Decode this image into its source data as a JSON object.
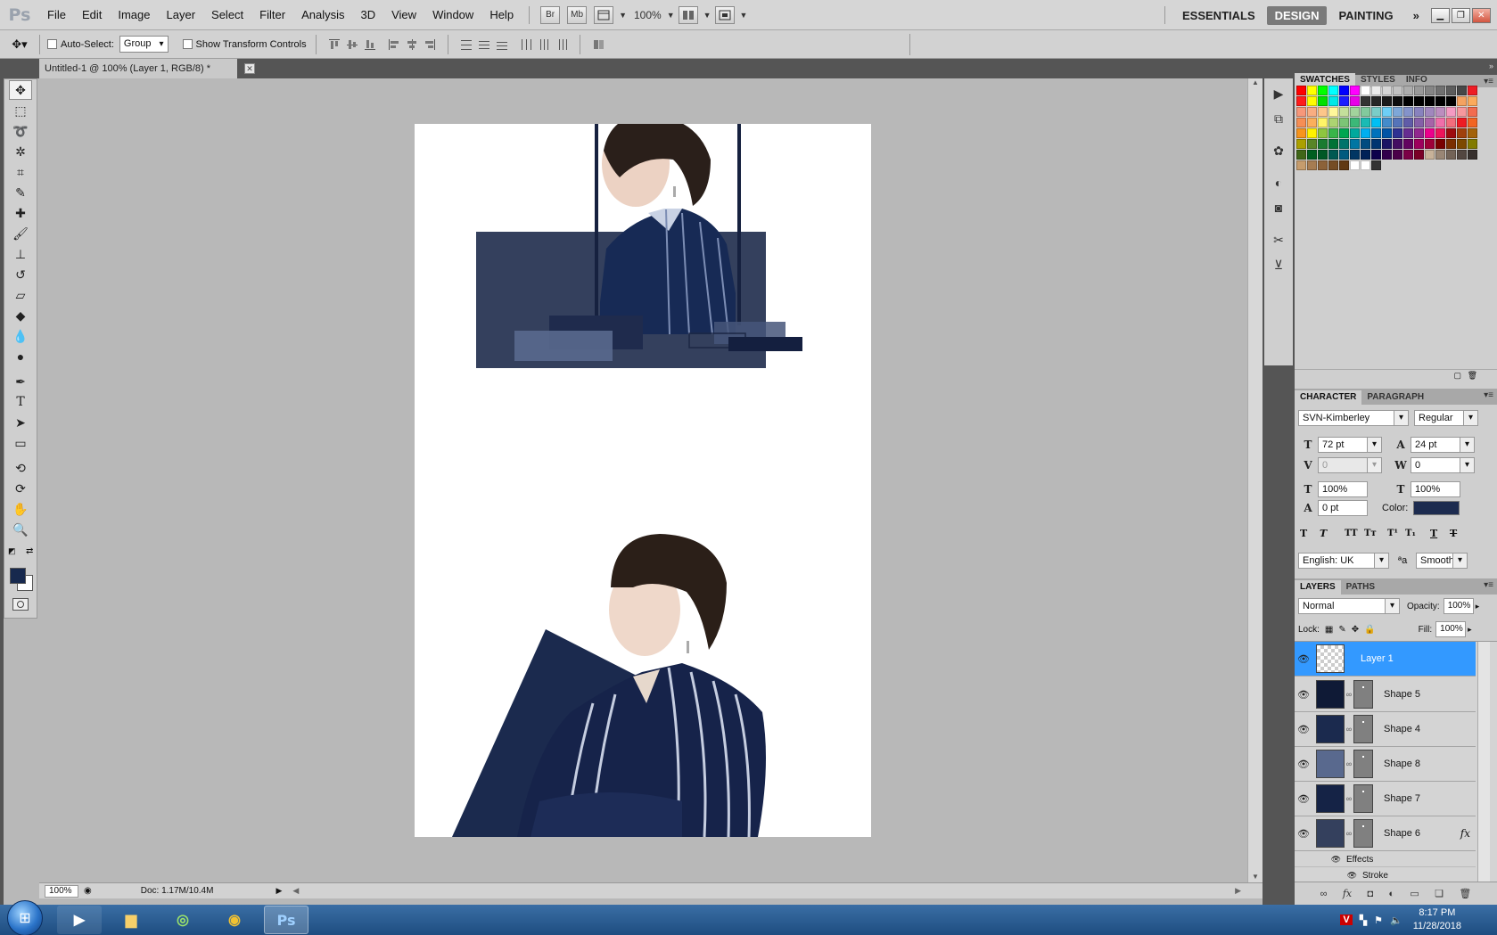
{
  "app": {
    "logo": "Ps"
  },
  "menu": [
    "File",
    "Edit",
    "Image",
    "Layer",
    "Select",
    "Filter",
    "Analysis",
    "3D",
    "View",
    "Window",
    "Help"
  ],
  "menubar_buttons": {
    "bridge": "Br",
    "minibridge": "Mb",
    "zoom": "100%"
  },
  "workspaces": [
    "ESSENTIALS",
    "DESIGN",
    "PAINTING"
  ],
  "workspace_more": "»",
  "options": {
    "auto_select_label": "Auto-Select:",
    "auto_select_value": "Group",
    "transform_label": "Show Transform Controls"
  },
  "document": {
    "tab_title": "Untitled-1 @ 100% (Layer 1, RGB/8) *",
    "zoom": "100%",
    "doc_size": "Doc: 1.17M/10.4M"
  },
  "swatches_panel": {
    "tabs": [
      "SWATCHES",
      "STYLES",
      "INFO"
    ],
    "colors": [
      "#ff0000",
      "#ffff00",
      "#00ff00",
      "#00ffff",
      "#0000ff",
      "#ff00ff",
      "#ffffff",
      "#ebebeb",
      "#d6d6d6",
      "#c2c2c2",
      "#adadad",
      "#999999",
      "#858585",
      "#707070",
      "#5c5c5c",
      "#474747",
      "#ee1c24",
      "#ff1b1b",
      "#fffb00",
      "#00e000",
      "#00e8e8",
      "#1b1bff",
      "#e800e8",
      "#333333",
      "#262626",
      "#1a1a1a",
      "#0d0d0d",
      "#000000",
      "#000000",
      "#000000",
      "#000000",
      "#000000",
      "#f4a261",
      "#fbaa5c",
      "#f7977a",
      "#f9ad81",
      "#fdc68a",
      "#fff79a",
      "#c4df9b",
      "#a2d39c",
      "#82ca9d",
      "#7bcdc8",
      "#6ecff6",
      "#7ea7d8",
      "#8493ca",
      "#8882be",
      "#a187be",
      "#bc8dbf",
      "#f49ac2",
      "#f6989d",
      "#f26c4f",
      "#f68e55",
      "#fbaf5c",
      "#fff467",
      "#acd372",
      "#7cc576",
      "#3bb878",
      "#1abbb4",
      "#00bff3",
      "#438ccb",
      "#5574b9",
      "#605ca8",
      "#855fa8",
      "#a763a8",
      "#f06ea9",
      "#f26d7d",
      "#ed1c24",
      "#f26522",
      "#f7941d",
      "#fff200",
      "#8dc63f",
      "#39b54a",
      "#00a651",
      "#00a99d",
      "#00aeef",
      "#0072bc",
      "#0054a6",
      "#2e3192",
      "#662d91",
      "#92278f",
      "#ec008c",
      "#ed145b",
      "#9e0b0f",
      "#a0410d",
      "#a36209",
      "#aba000",
      "#598527",
      "#1a7b30",
      "#007236",
      "#00746b",
      "#0076a3",
      "#004b80",
      "#003471",
      "#1b1464",
      "#440e62",
      "#630460",
      "#9e005d",
      "#9e0039",
      "#790000",
      "#7b2e00",
      "#7d4900",
      "#827b00",
      "#406618",
      "#005e20",
      "#005826",
      "#005952",
      "#005b7f",
      "#003663",
      "#002157",
      "#0d004c",
      "#32004b",
      "#4b0049",
      "#7b0046",
      "#7a0026",
      "#c7b299",
      "#998675",
      "#736357",
      "#534741",
      "#37302d",
      "#c69c6d",
      "#a67c52",
      "#8c6239",
      "#754c24",
      "#603913",
      "#ffffff",
      "#ffffff",
      "#333333"
    ]
  },
  "character_panel": {
    "tabs": [
      "CHARACTER",
      "PARAGRAPH"
    ],
    "font_family": "SVN-Kimberley",
    "font_style": "Regular",
    "font_size": "72 pt",
    "leading": "24 pt",
    "kerning": "0",
    "tracking": "0",
    "vertical_scale": "100%",
    "horizontal_scale": "100%",
    "baseline_shift": "0 pt",
    "color_label": "Color:",
    "color": "#1c2b4f",
    "language": "English: UK",
    "antialias_icon": "ªa",
    "antialias": "Smooth"
  },
  "layers_panel": {
    "tabs": [
      "LAYERS",
      "PATHS"
    ],
    "blend_mode": "Normal",
    "opacity_label": "Opacity:",
    "opacity": "100%",
    "lock_label": "Lock:",
    "fill_label": "Fill:",
    "fill": "100%",
    "layers": [
      {
        "name": "Layer 1",
        "color": "#ffffff",
        "selected": true
      },
      {
        "name": "Shape 5",
        "color": "#0f1a36",
        "selected": false
      },
      {
        "name": "Shape 4",
        "color": "#1b2a4e",
        "selected": false
      },
      {
        "name": "Shape 8",
        "color": "#59698e",
        "selected": false
      },
      {
        "name": "Shape 7",
        "color": "#152346",
        "selected": false
      },
      {
        "name": "Shape 6",
        "color": "#34405d",
        "selected": false
      }
    ],
    "fx_label": "fx",
    "effects_label": "Effects",
    "stroke_label": "Stroke"
  },
  "taskbar": {
    "time": "8:17 PM",
    "date": "11/28/2018"
  }
}
